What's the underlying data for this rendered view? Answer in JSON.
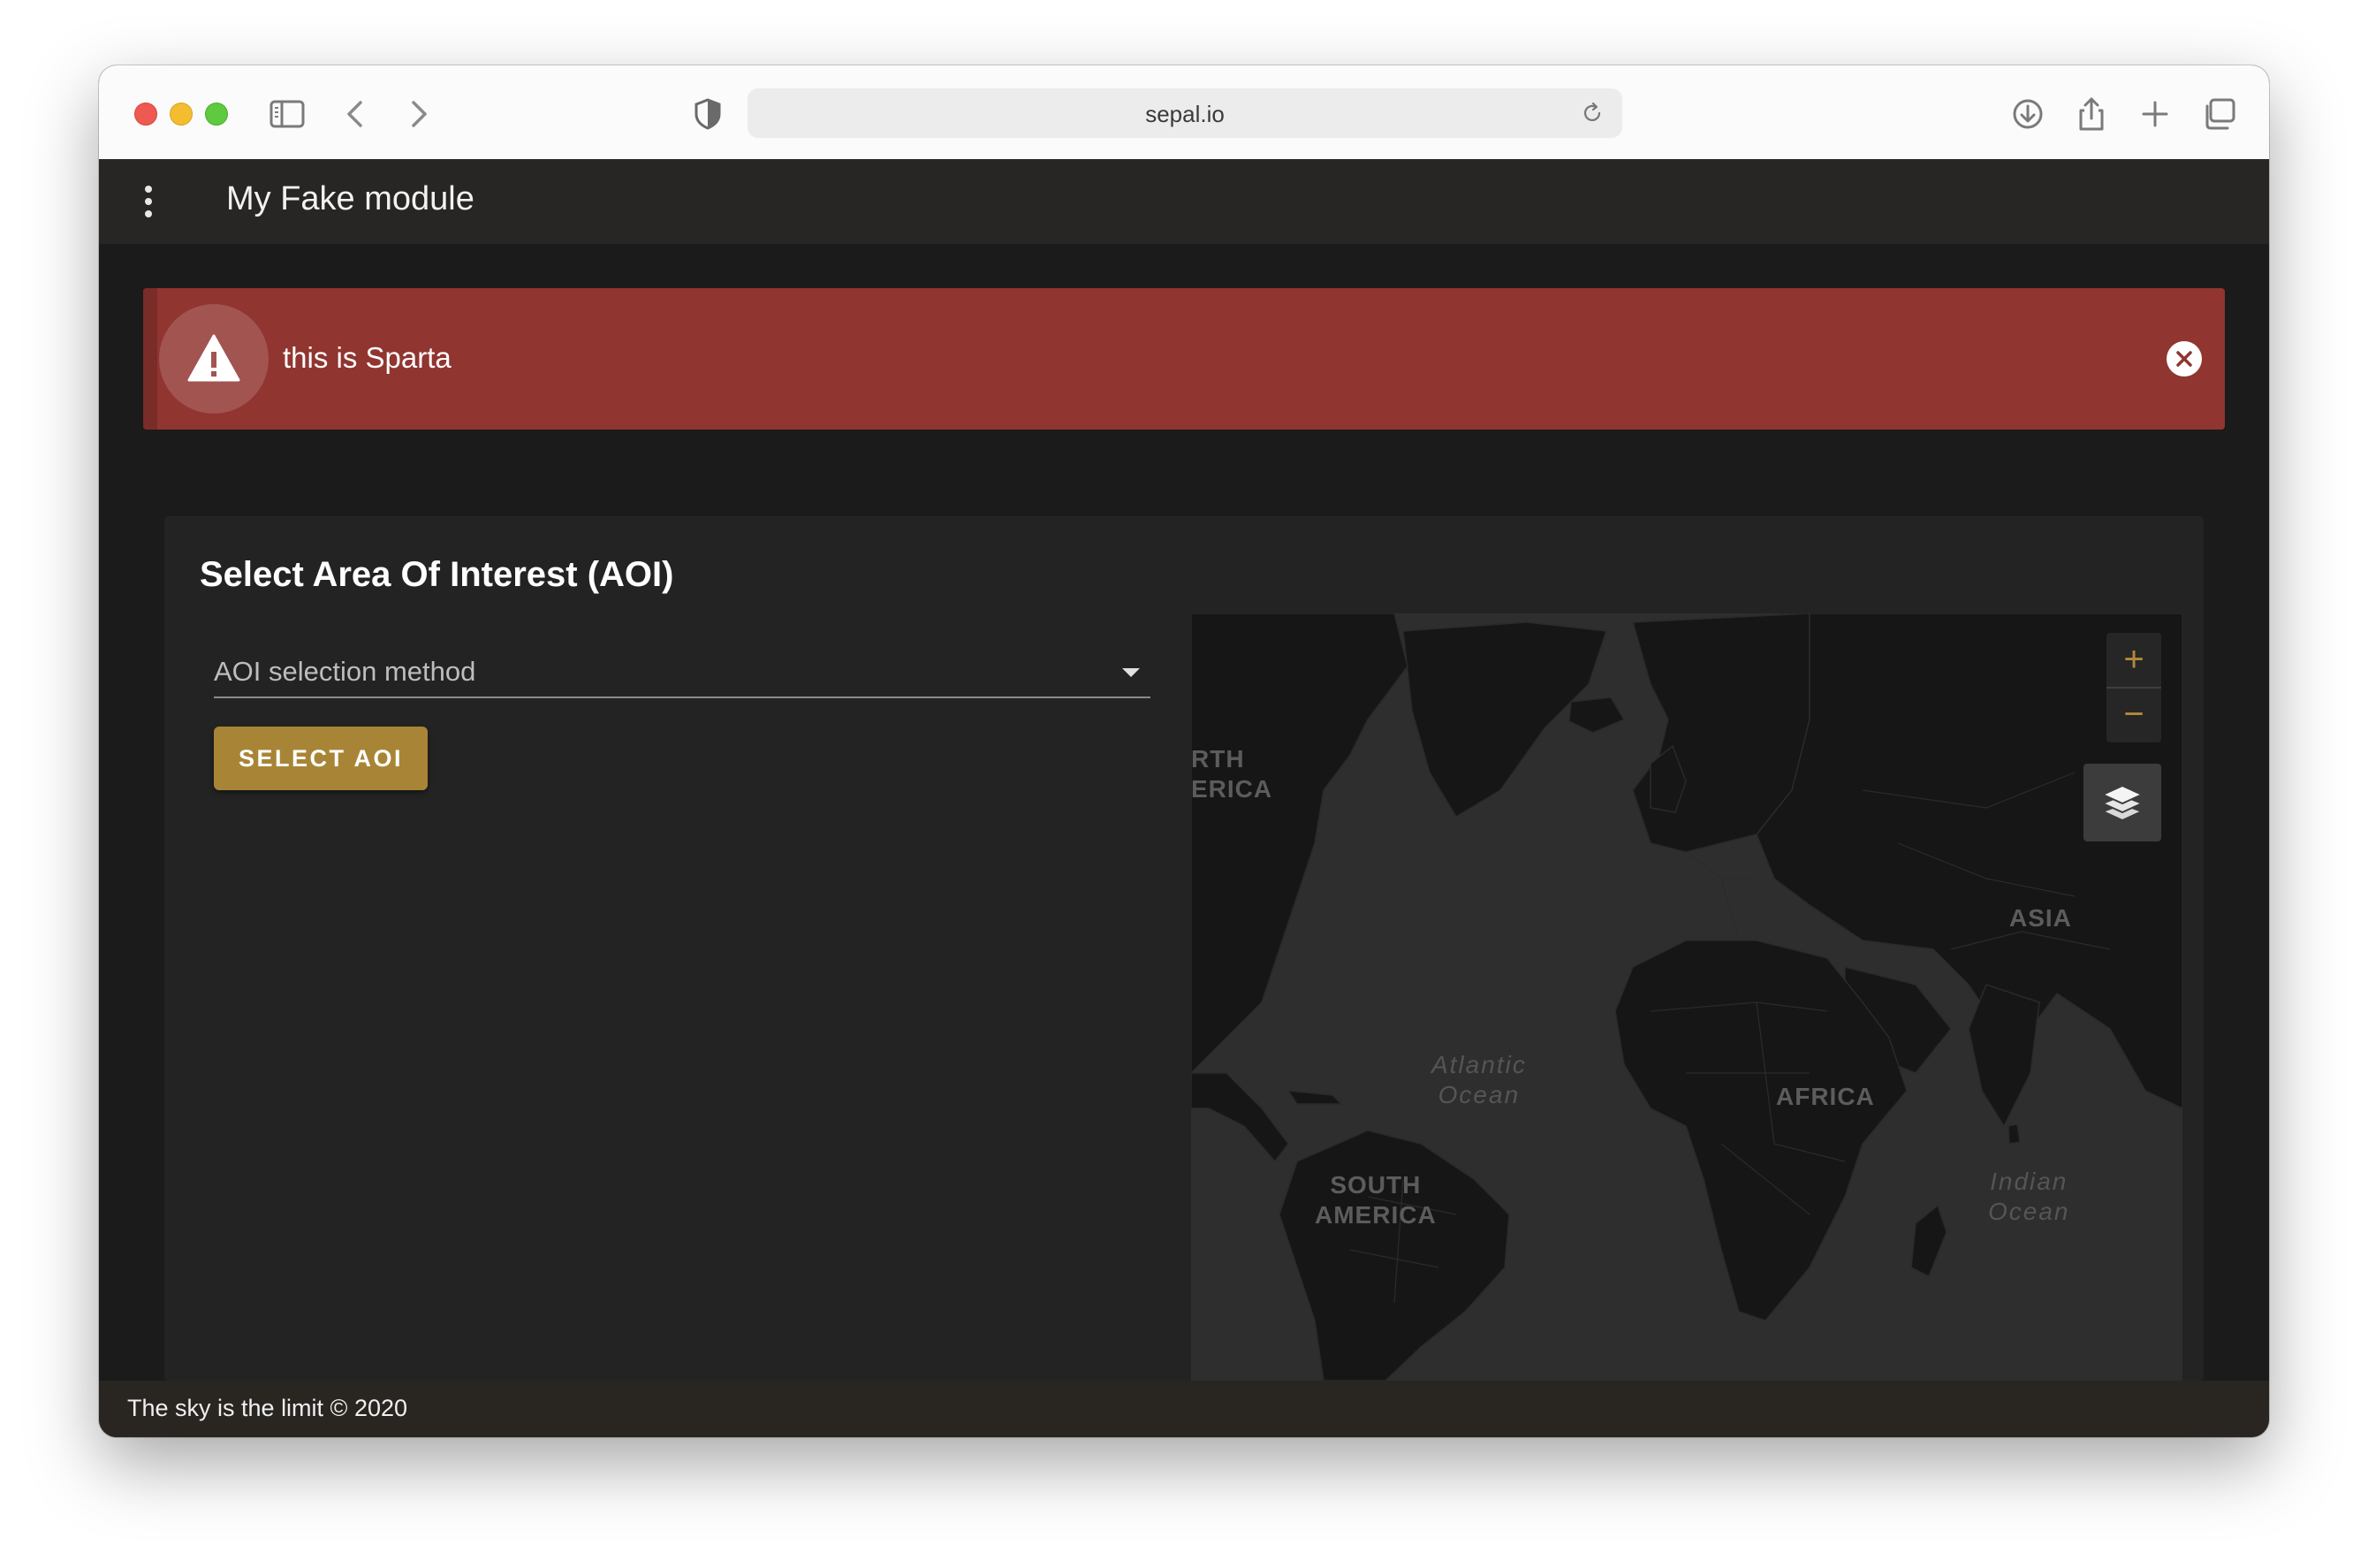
{
  "browser": {
    "url": "sepal.io"
  },
  "app": {
    "title": "My Fake module"
  },
  "alert": {
    "message": "this is Sparta",
    "color": "#903530"
  },
  "card": {
    "title": "Select Area Of Interest (AOI)",
    "select_label": "AOI selection method",
    "button_label": "SELECT AOI",
    "accent": "#a88536"
  },
  "map": {
    "labels": {
      "north_america": "RTH\nERICA",
      "asia": "ASIA",
      "atlantic": "Atlantic\nOcean",
      "africa": "AFRICA",
      "south_america": "SOUTH\nAMERICA",
      "indian": "Indian\nOcean"
    },
    "zoom_in": "+",
    "zoom_out": "−"
  },
  "footer": {
    "text": "The sky is the limit © 2020"
  }
}
